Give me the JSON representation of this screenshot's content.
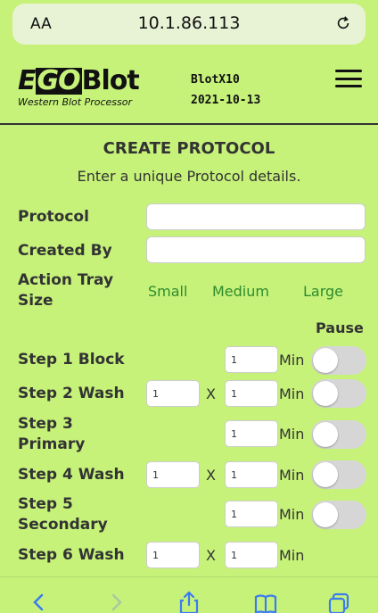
{
  "browser": {
    "aa_label": "AA",
    "url": "10.1.86.113"
  },
  "header": {
    "logo_prefix": "E",
    "logo_go": "GO",
    "logo_name": "Blot",
    "logo_subtitle": "Western Blot Processor",
    "device_name": "BlotX10",
    "date": "2021-10-13"
  },
  "form": {
    "title": "CREATE PROTOCOL",
    "subtitle": "Enter a unique Protocol details.",
    "protocol_label": "Protocol",
    "protocol_value": "",
    "created_by_label": "Created By",
    "created_by_value": "",
    "tray_label_line1": "Action Tray",
    "tray_label_line2": "Size",
    "tray_sizes": [
      "Small",
      "Medium",
      "Large"
    ],
    "pause_header": "Pause",
    "x_label": "X",
    "min_label": "Min",
    "steps": [
      {
        "label_line1": "Step 1 Block",
        "label_line2": "",
        "repeat": "",
        "minutes": "1",
        "pause": false
      },
      {
        "label_line1": "Step 2 Wash",
        "label_line2": "",
        "repeat": "1",
        "minutes": "1",
        "pause": false
      },
      {
        "label_line1": "Step 3",
        "label_line2": "Primary",
        "repeat": "",
        "minutes": "1",
        "pause": false
      },
      {
        "label_line1": "Step 4 Wash",
        "label_line2": "",
        "repeat": "1",
        "minutes": "1",
        "pause": false
      },
      {
        "label_line1": "Step 5",
        "label_line2": "Secondary",
        "repeat": "",
        "minutes": "1",
        "pause": false
      },
      {
        "label_line1": "Step 6 Wash",
        "label_line2": "",
        "repeat": "1",
        "minutes": "1",
        "pause": false
      }
    ]
  },
  "colors": {
    "background": "#c6f27a",
    "accent_text": "#2e8b2e",
    "toolbar_icon": "#3b7cf0"
  },
  "toolbar": {
    "icons": [
      "back-icon",
      "forward-icon",
      "share-icon",
      "bookmarks-icon",
      "tabs-icon"
    ]
  }
}
